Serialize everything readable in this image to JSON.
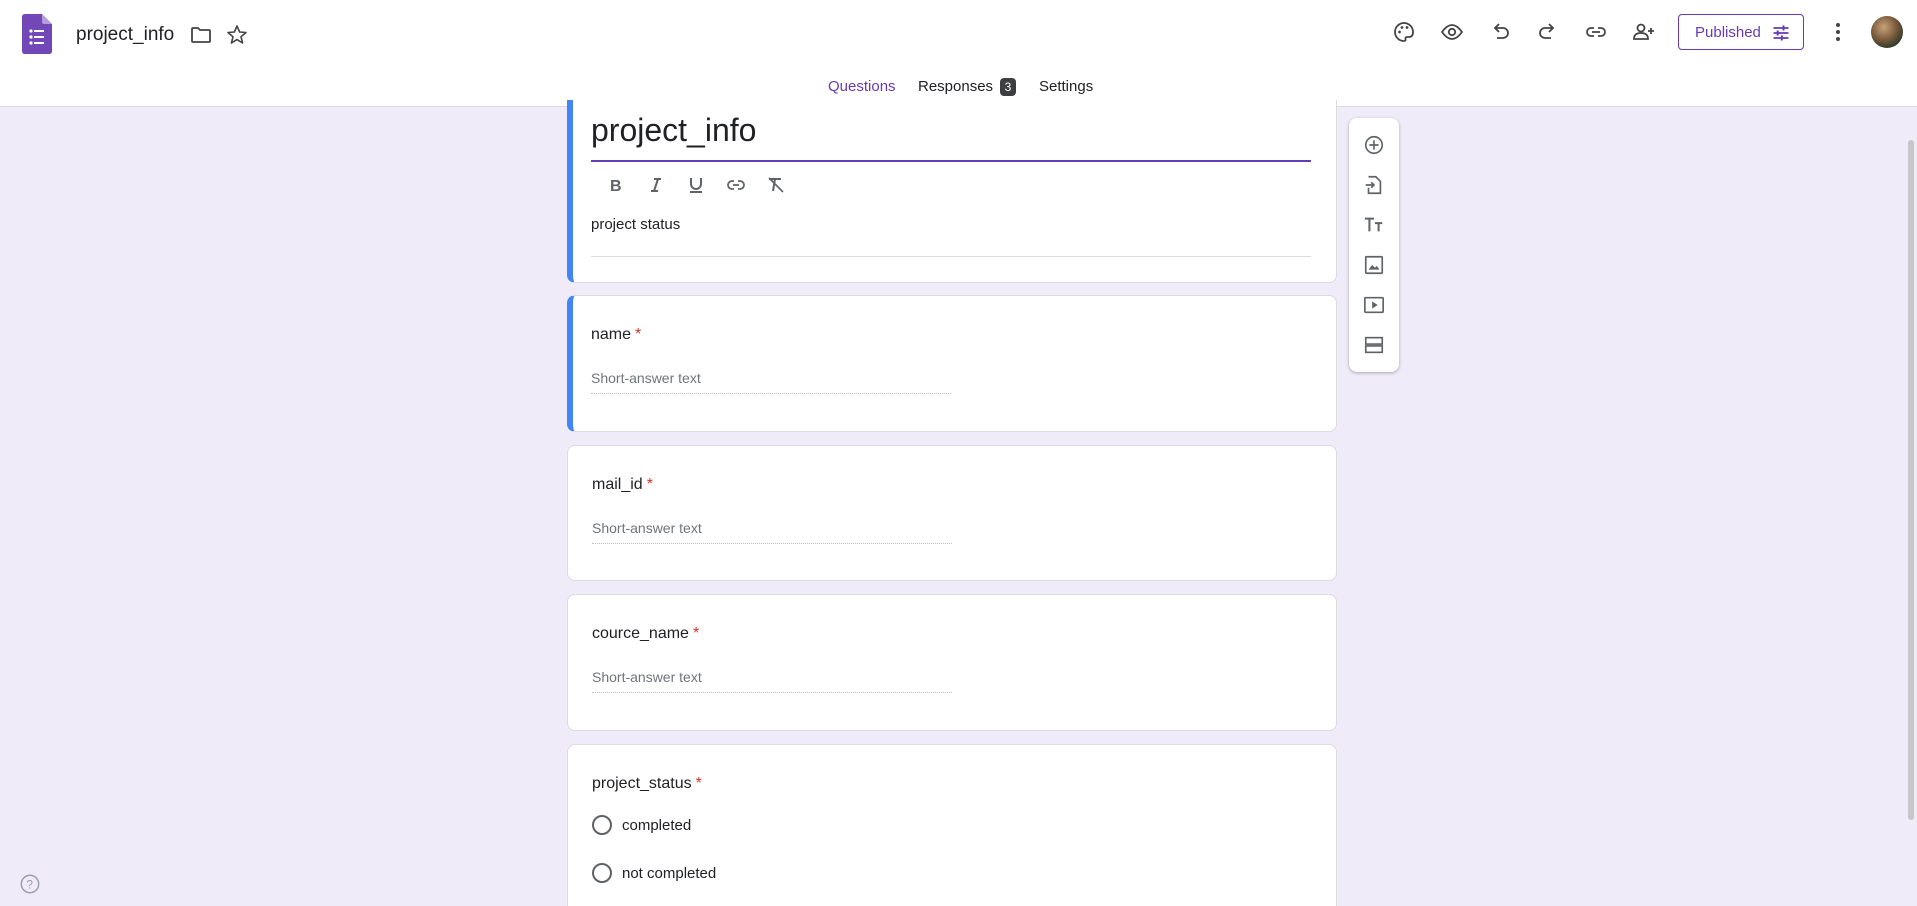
{
  "header": {
    "doc_title": "project_info",
    "icons": [
      "forms-logo-icon",
      "folder-icon",
      "star-icon",
      "palette-icon",
      "eye-icon",
      "undo-icon",
      "redo-icon",
      "link-icon",
      "add-person-icon",
      "more-vert-icon"
    ],
    "published_label": "Published"
  },
  "tabs": [
    {
      "label": "Questions",
      "active": true
    },
    {
      "label": "Responses",
      "badge": "3"
    },
    {
      "label": "Settings"
    }
  ],
  "form": {
    "title": "project_info",
    "description": "project status",
    "format_tools": [
      "bold-icon",
      "italic-icon",
      "underline-icon",
      "link-icon",
      "clear-format-icon"
    ],
    "questions": [
      {
        "title": "name",
        "required_mark": "*",
        "placeholder": "Short-answer text"
      },
      {
        "title": "mail_id",
        "required_mark": "*",
        "placeholder": "Short-answer text"
      },
      {
        "title": "cource_name",
        "required_mark": "*",
        "placeholder": "Short-answer text"
      },
      {
        "title": "project_status",
        "required_mark": "*",
        "options": [
          "completed",
          "not completed"
        ]
      }
    ]
  },
  "side_toolbar": [
    "add-question-icon",
    "import-questions-icon",
    "add-title-icon",
    "add-image-icon",
    "add-video-icon",
    "add-section-icon"
  ],
  "colors": {
    "accent": "#673ab7",
    "selected_bar": "#4285f4",
    "background": "#f0ebf8",
    "required": "#d93025"
  }
}
